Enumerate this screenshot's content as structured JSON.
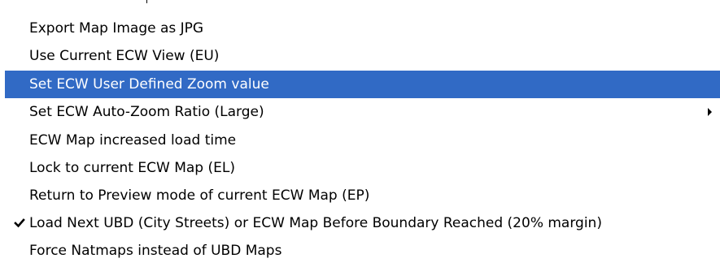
{
  "menu": {
    "items": [
      {
        "label": "Export Map Image as JPG",
        "highlighted": false,
        "checked": false,
        "has_submenu": false
      },
      {
        "label": "Use Current ECW View (EU)",
        "highlighted": false,
        "checked": false,
        "has_submenu": false
      },
      {
        "label": "Set ECW User Defined Zoom value",
        "highlighted": true,
        "checked": false,
        "has_submenu": false
      },
      {
        "label": "Set ECW Auto-Zoom Ratio (Large)",
        "highlighted": false,
        "checked": false,
        "has_submenu": true
      },
      {
        "label": "ECW Map increased load time",
        "highlighted": false,
        "checked": false,
        "has_submenu": false
      },
      {
        "label": "Lock to current ECW Map (EL)",
        "highlighted": false,
        "checked": false,
        "has_submenu": false
      },
      {
        "label": "Return to Preview mode of current ECW Map (EP)",
        "highlighted": false,
        "checked": false,
        "has_submenu": false
      },
      {
        "label": "Load Next UBD (City Streets) or ECW Map Before Boundary Reached (20% margin)",
        "highlighted": false,
        "checked": true,
        "has_submenu": false
      },
      {
        "label": "Force Natmaps instead of UBD Maps",
        "highlighted": false,
        "checked": false,
        "has_submenu": false
      }
    ]
  },
  "colors": {
    "highlight_background": "#316ac5",
    "highlight_text": "#ffffff",
    "menu_background": "#ffffff",
    "text": "#000000"
  },
  "icons": {
    "checked_item": "check-mark-icon",
    "submenu_item": "submenu-arrow-icon"
  }
}
